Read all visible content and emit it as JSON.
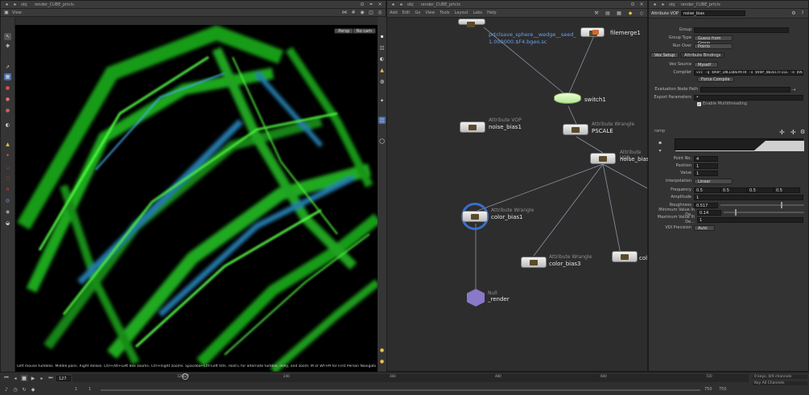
{
  "left_pane": {
    "path_obj": "obj",
    "path_node": "render_CUBE_prtcls",
    "view_tab": "View",
    "camera_menu": "Persp",
    "light_menu": "No cam",
    "status_bar": "Left mouse tumbles. Middle pans. Right dollies. Ctrl+Alt+Left box zooms. Ctrl+Right zooms. Spacebar-Ctrl-Left tilts. Hold L for alternate tumble, dolly, and zoom.    M or Wf+M for First Person Navigation."
  },
  "network": {
    "path_obj": "obj",
    "path_node": "render_CUBE_prtcls",
    "menu": [
      "Add",
      "Edit",
      "Go",
      "View",
      "Tools",
      "Layout",
      "Labs",
      "Help"
    ],
    "nodes": [
      {
        "type": "",
        "name": "prtclsave_sphere__wedge__seed_",
        "name2": "1.000000.$F4.bgeo.sc"
      },
      {
        "type": "",
        "name": "filemerge1"
      },
      {
        "type": "",
        "name": "switch1"
      },
      {
        "type": "Attribute VOP",
        "name": "noise_bias1"
      },
      {
        "type": "Attribute Wrangle",
        "name": "PSCALE"
      },
      {
        "type": "Attribute VOP",
        "name": "noise_bias"
      },
      {
        "type": "Attribute Wrangle",
        "name": "color_bias1"
      },
      {
        "type": "Attribute Wrangle",
        "name": "color_bias3"
      },
      {
        "type": "",
        "name": "col"
      },
      {
        "type": "Null",
        "name": "_render"
      }
    ]
  },
  "params": {
    "path_obj": "obj",
    "path_node": "render_CUBE_prtcls",
    "node_type": "Attribute VOP",
    "node_name": "noise_bias",
    "group_label": "Group",
    "group_type_label": "Group Type",
    "group_type_value": "Guess from Group",
    "run_over_label": "Run Over",
    "run_over_value": "Points",
    "tabs": [
      "Vex Setup",
      "Attribute Bindings"
    ],
    "vex_source_label": "Vex Source",
    "vex_source_value": "Myself",
    "compiler_label": "Compiler",
    "compiler_value": "vcc -q $VOP_INCLUDEPATH -o $VOP_OBJECTFILE -e $VOP_",
    "force_compile": "Force Compile",
    "eval_node_path_label": "Evaluation Node Path",
    "export_params_label": "Export Parameters",
    "export_params_value": "*",
    "multithread_label": "Enable Multithreading",
    "ramp_label": "ramp",
    "point_no_label": "Point No.",
    "point_no_value": "4",
    "position_label": "Position",
    "position_value": "1",
    "value_label": "Value",
    "value_value": "1",
    "interp_label": "Interpolation",
    "interp_value": "Linear",
    "frequency_label": "Frequency",
    "frequency_values": [
      "0.5",
      "0.5",
      "0.5",
      "0.5"
    ],
    "amplitude_label": "Amplitude",
    "amplitude_value": "1",
    "roughness_label": "Roughness",
    "roughness_value": "0.517",
    "minval_label": "Minimum Value In De...",
    "minval_value": "0.14",
    "maxval_label": "Maximum Value In De...",
    "maxval_value": "1",
    "vdi_label": "VDI Precision",
    "vdi_value": "Auto"
  },
  "timeline": {
    "frame": "127",
    "start": "1",
    "start2": "1",
    "end": "750",
    "end2": "750",
    "ticks": [
      "120",
      "240",
      "360",
      "480",
      "600",
      "720"
    ],
    "cursor_label": "127",
    "keys_label": "0 keys, 0/0 channels",
    "key_all_label": "Key All Channels"
  },
  "colors": {
    "accent": "#f0c040",
    "particle": "#33dd22",
    "particle2": "#2a90c8",
    "bg_net": "#2d2d2d"
  }
}
